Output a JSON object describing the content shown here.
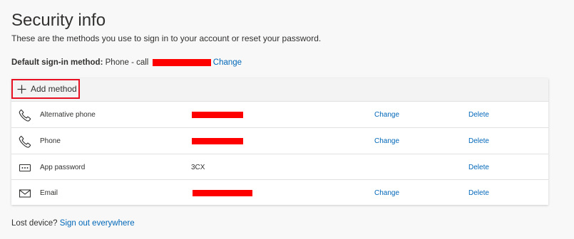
{
  "page": {
    "title": "Security info",
    "subtitle": "These are the methods you use to sign in to your account or reset your password."
  },
  "default_method": {
    "label": "Default sign-in method:",
    "value": "Phone - call",
    "change_label": "Change"
  },
  "card": {
    "add_method_label": "Add method",
    "methods": [
      {
        "icon": "phone-icon",
        "name": "Alternative phone",
        "detail": "",
        "change": "Change",
        "delete": "Delete"
      },
      {
        "icon": "phone-icon",
        "name": "Phone",
        "detail": "",
        "change": "Change",
        "delete": "Delete"
      },
      {
        "icon": "password-dots-icon",
        "name": "App password",
        "detail": "3CX",
        "change": "",
        "delete": "Delete"
      },
      {
        "icon": "mail-icon",
        "name": "Email",
        "detail": "",
        "change": "Change",
        "delete": "Delete"
      }
    ]
  },
  "footer": {
    "lost_device": "Lost device?",
    "sign_out_everywhere": "Sign out everywhere"
  },
  "colors": {
    "link": "#0067b8",
    "highlight_border": "#e81123",
    "redaction": "#ff0000"
  }
}
